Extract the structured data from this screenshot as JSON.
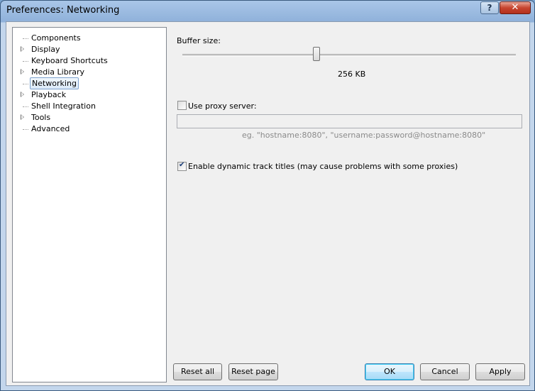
{
  "window": {
    "title": "Preferences: Networking",
    "help_glyph": "?",
    "close_glyph": "✕"
  },
  "tree": {
    "items": [
      {
        "label": "Components",
        "expandable": false
      },
      {
        "label": "Display",
        "expandable": true
      },
      {
        "label": "Keyboard Shortcuts",
        "expandable": false
      },
      {
        "label": "Media Library",
        "expandable": true
      },
      {
        "label": "Networking",
        "expandable": false,
        "selected": true
      },
      {
        "label": "Playback",
        "expandable": true
      },
      {
        "label": "Shell Integration",
        "expandable": false
      },
      {
        "label": "Tools",
        "expandable": true
      },
      {
        "label": "Advanced",
        "expandable": false
      }
    ]
  },
  "networking": {
    "buffer_label": "Buffer size:",
    "buffer_value": "256 KB",
    "proxy_label": "Use proxy server:",
    "proxy_checked": false,
    "proxy_value": "",
    "proxy_hint": "eg. \"hostname:8080\", \"username:password@hostname:8080\"",
    "dynamic_titles_label": "Enable dynamic track titles (may cause problems with some proxies)",
    "dynamic_titles_checked": true
  },
  "buttons": {
    "reset_all": "Reset all",
    "reset_page": "Reset page",
    "ok": "OK",
    "cancel": "Cancel",
    "apply": "Apply"
  }
}
